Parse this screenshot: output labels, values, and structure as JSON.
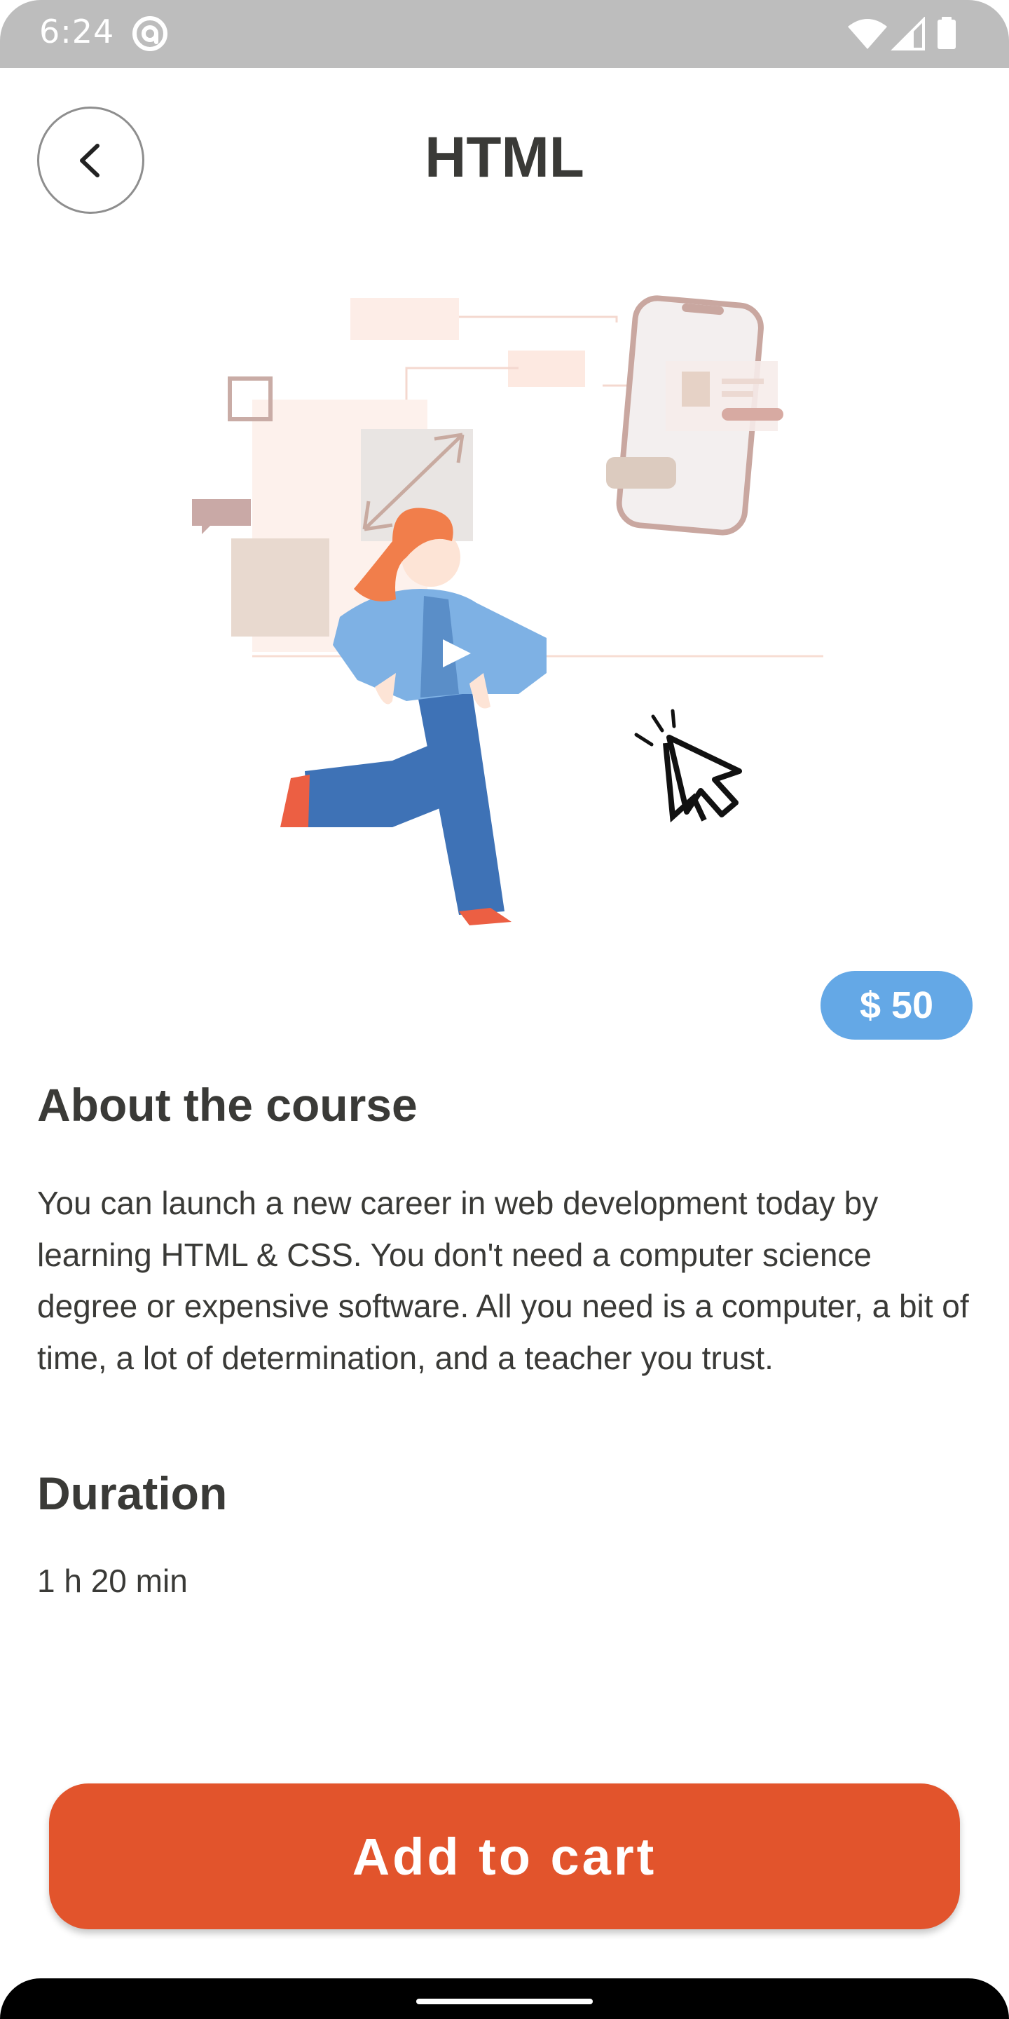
{
  "status_bar": {
    "time": "6:24",
    "icons": [
      "at-sign-icon",
      "wifi-icon",
      "cellular-signal-icon",
      "battery-icon"
    ]
  },
  "header": {
    "back_icon": "chevron-left-icon",
    "title": "HTML"
  },
  "hero": {
    "description": "illustration-of-developer-with-phone-and-cursor"
  },
  "course": {
    "price": "$ 50",
    "about_title": "About the course",
    "about_text": "You can launch a new career in web development today by learning HTML & CSS. You don't need a computer science degree or expensive software. All you need is a computer, a bit of time, a lot of determination, and a teacher you trust.",
    "duration_title": "Duration",
    "duration_value": "1 h 20 min"
  },
  "actions": {
    "add_to_cart_label": "Add to cart"
  },
  "colors": {
    "accent": "#e2542c",
    "price_badge": "#64a8e6",
    "text": "#3a3a37",
    "status_bar": "#bdbdbd"
  }
}
